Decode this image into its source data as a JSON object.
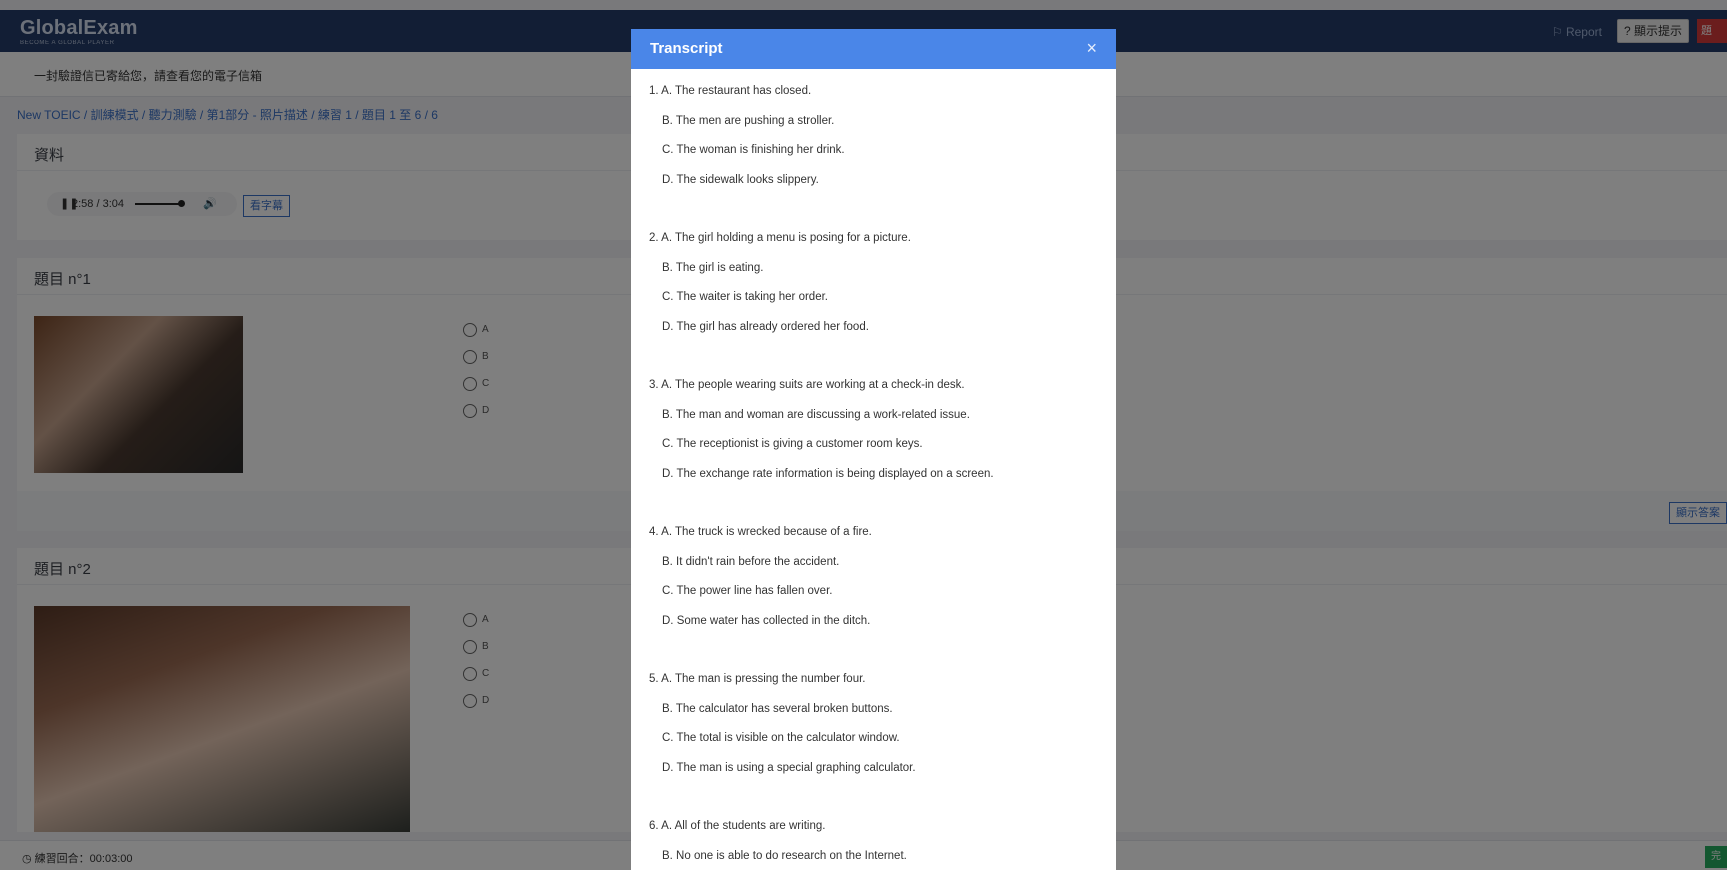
{
  "header": {
    "logo_name": "GlobalExam",
    "logo_tagline": "BECOME A GLOBAL PLAYER",
    "report_label": "Report",
    "tips_label": "顯示提示",
    "red_button_label": "題"
  },
  "notice": "一封驗證信已寄給您，請查看您的電子信箱",
  "breadcrumb": "New TOEIC / 訓練模式 / 聽力測驗 / 第1部分 - 照片描述 / 練習 1 / 題目 1 至 6 / 6",
  "material": {
    "title": "資料",
    "player_time": "2:58 / 3:04",
    "subtitle_button": "看字幕"
  },
  "questions": [
    {
      "title": "題目 n°1",
      "options": [
        "A",
        "B",
        "C",
        "D"
      ]
    },
    {
      "title": "題目 n°2",
      "options": [
        "A",
        "B",
        "C",
        "D"
      ]
    }
  ],
  "show_answer_label": "顯示答案",
  "footer": {
    "timer": "練習回合：00:03:00",
    "finish_label": "完"
  },
  "modal": {
    "title": "Transcript",
    "close": "×",
    "groups": [
      {
        "lines": [
          "1. A. The restaurant has closed.",
          "B. The men are pushing a stroller.",
          "C. The woman is finishing her drink.",
          "D. The sidewalk looks slippery."
        ]
      },
      {
        "lines": [
          "2. A. The girl holding a menu is posing for a picture.",
          "B. The girl is eating.",
          "C. The waiter is taking her order.",
          "D. The girl has already ordered her food."
        ]
      },
      {
        "lines": [
          "3. A. The people wearing suits are working at a check-in desk.",
          "B. The man and woman are discussing a work-related issue.",
          "C. The receptionist is giving a customer room keys.",
          "D. The exchange rate information is being displayed on a screen."
        ]
      },
      {
        "lines": [
          "4. A. The truck is wrecked because of a fire.",
          "B. It didn't rain before the accident.",
          "C. The power line has fallen over.",
          "D. Some water has collected in the ditch."
        ]
      },
      {
        "lines": [
          "5. A. The man is pressing the number four.",
          "B. The calculator has several broken buttons.",
          "C. The total is visible on the calculator window.",
          "D. The man is using a special graphing calculator."
        ]
      },
      {
        "lines": [
          "6. A. All of the students are writing.",
          "B. No one is able to do research on the Internet."
        ]
      }
    ]
  }
}
